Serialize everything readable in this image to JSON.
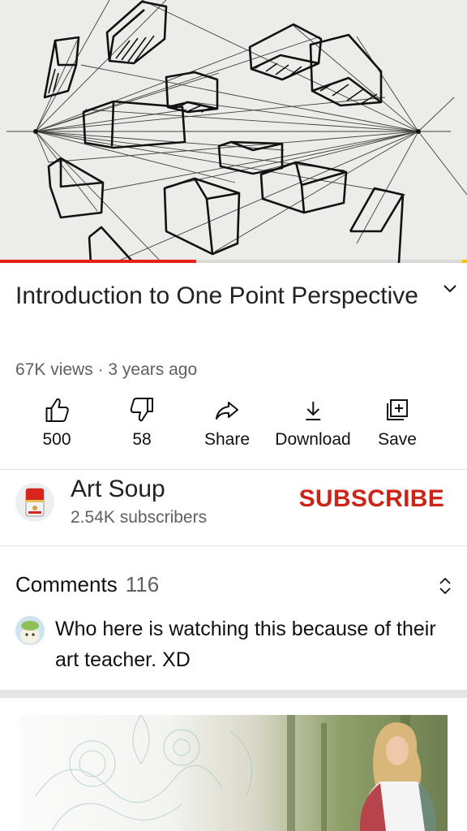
{
  "video": {
    "title": "Introduction to One Point Perspective",
    "views": "67K views",
    "separator": "·",
    "age": "3 years ago",
    "progress_fraction": 0.42
  },
  "actions": [
    {
      "label": "500",
      "icon": "like-icon"
    },
    {
      "label": "58",
      "icon": "dislike-icon"
    },
    {
      "label": "Share",
      "icon": "share-icon"
    },
    {
      "label": "Download",
      "icon": "download-icon"
    },
    {
      "label": "Save",
      "icon": "save-to-playlist-icon"
    }
  ],
  "channel": {
    "name": "Art Soup",
    "subscribers": "2.54K subscribers",
    "subscribe_label": "SUBSCRIBE",
    "avatar_icon": "soup-can-avatar"
  },
  "comments": {
    "heading": "Comments",
    "count": "116",
    "top_comment": "Who here is watching this because of their art teacher. XD",
    "expand_icon": "unfold-icon"
  },
  "colors": {
    "accent_red": "#cc2419",
    "progress_red": "#e62117",
    "secondary_text": "#606060"
  }
}
